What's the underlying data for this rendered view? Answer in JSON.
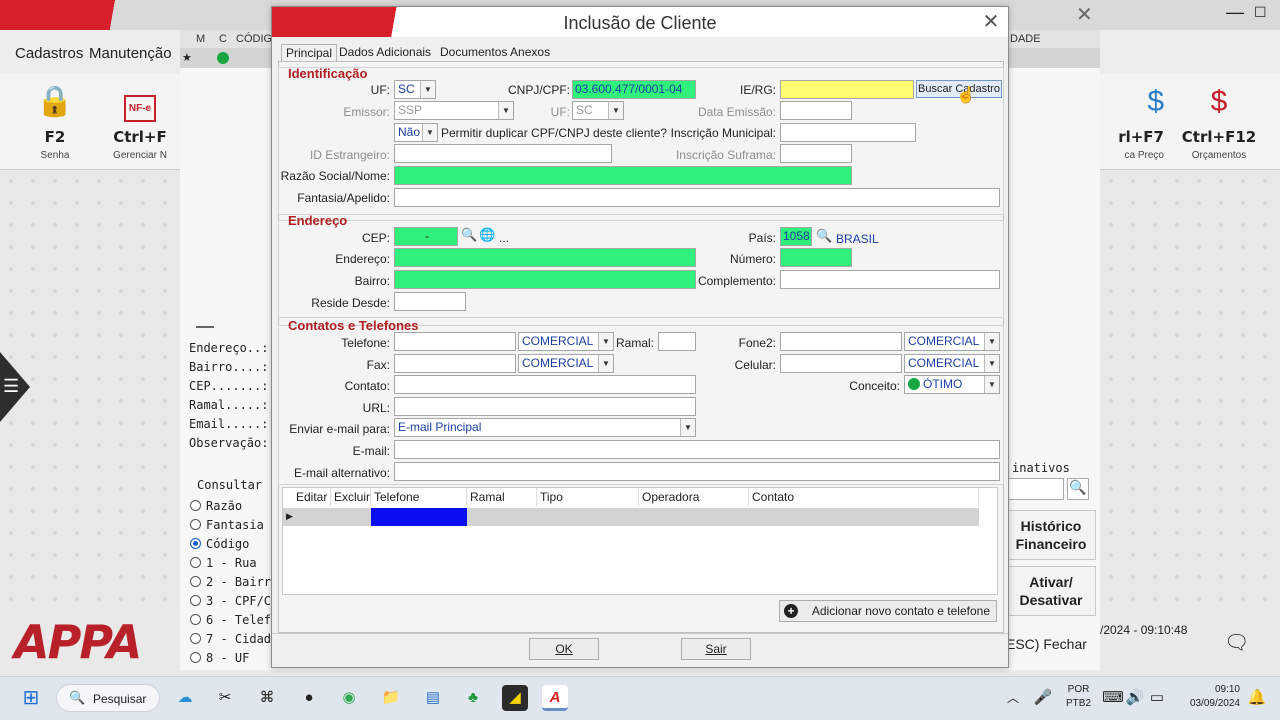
{
  "background": {
    "menu": [
      "Cadastros",
      "Manutenção"
    ],
    "table_header": [
      "M",
      "C",
      "CÓDIG",
      "DADE"
    ],
    "tools_left": [
      {
        "key": "F2",
        "sub": "Senha",
        "icon": "lock-icon"
      },
      {
        "key": "Ctrl+F",
        "sub": "Gerenciar N",
        "icon": "nfe-icon"
      }
    ],
    "tools_right": [
      {
        "key": "rl+F7",
        "sub": "ca Preço",
        "icon": "price-icon"
      },
      {
        "key": "Ctrl+F12",
        "sub": "Orçamentos",
        "icon": "budget-icon"
      }
    ],
    "detail_labels": [
      "Endereço..:",
      "Bairro....:",
      "CEP.......:",
      "Ramal.....:",
      "Email.....:",
      "Observação:"
    ],
    "consultar": {
      "title": "Consultar",
      "options": [
        "Razão",
        "Fantasia",
        "Código",
        "1 - Rua",
        "2 - Bairr",
        "3 - CPF/C",
        "6 - Telef",
        "7 - Cidad",
        "8 - UF"
      ],
      "selected": "Código"
    },
    "inativos": "inativos",
    "historico_button": "Histórico Financeiro",
    "ativar_button": "Ativar/ Desativar",
    "fechar_button": "ESC) Fechar",
    "datetime_status": "/2024 - 09:10:48",
    "logo": "APPA"
  },
  "taskbar": {
    "search_label": "Pesquisar",
    "lang1": "POR",
    "lang2": "PTB2",
    "time": "09:10",
    "date": "03/09/2024"
  },
  "dialog": {
    "title": "Inclusão de Cliente",
    "tabs": [
      "Principal",
      "Dados Adicionais",
      "Documentos Anexos"
    ],
    "active_tab": "Principal",
    "identificacao": {
      "header": "Identificação",
      "uf_label": "UF:",
      "uf_value": "SC",
      "cnpj_label": "CNPJ/CPF:",
      "cnpj_value": "03.600.477/0001-04",
      "ie_label": "IE/RG:",
      "ie_value": "",
      "buscar_button": "Buscar Cadastro",
      "emissor_label": "Emissor:",
      "emissor_value": "SSP",
      "uf2_label": "UF:",
      "uf2_value": "SC",
      "data_emissao_label": "Data Emissão:",
      "duplicar_value": "Não",
      "duplicar_label": "Permitir duplicar CPF/CNPJ deste cliente?",
      "insc_municipal_label": "Inscrição Municipal:",
      "id_estrangeiro_label": "ID Estrangeiro:",
      "insc_suframa_label": "Inscrição Suframa:",
      "razao_label": "Razão Social/Nome:",
      "fantasia_label": "Fantasia/Apelido:"
    },
    "endereco": {
      "header": "Endereço",
      "cep_label": "CEP:",
      "cep_value": "-",
      "more": "...",
      "pais_label": "País:",
      "pais_code": "1058",
      "pais_name": "BRASIL",
      "endereco_label": "Endereço:",
      "numero_label": "Número:",
      "bairro_label": "Bairro:",
      "complemento_label": "Complemento:",
      "reside_label": "Reside Desde:"
    },
    "contatos": {
      "header": "Contatos e Telefones",
      "telefone_label": "Telefone:",
      "telefone_tipo": "COMERCIAL",
      "ramal_label": "Ramal:",
      "fone2_label": "Fone2:",
      "fone2_tipo": "COMERCIAL",
      "fax_label": "Fax:",
      "fax_tipo": "COMERCIAL",
      "celular_label": "Celular:",
      "celular_tipo": "COMERCIAL",
      "contato_label": "Contato:",
      "conceito_label": "Conceito:",
      "conceito_value": "ÓTIMO",
      "url_label": "URL:",
      "enviar_label": "Enviar e-mail para:",
      "enviar_value": "E-mail Principal",
      "email_label": "E-mail:",
      "email_alt_label": "E-mail alternativo:"
    },
    "grid": {
      "columns": [
        "Editar",
        "Excluir",
        "Telefone",
        "Ramal",
        "Tipo",
        "Operadora",
        "Contato"
      ]
    },
    "add_contact_button": "Adicionar novo contato e telefone",
    "ok_button": "OK",
    "sair_button": "Sair"
  }
}
